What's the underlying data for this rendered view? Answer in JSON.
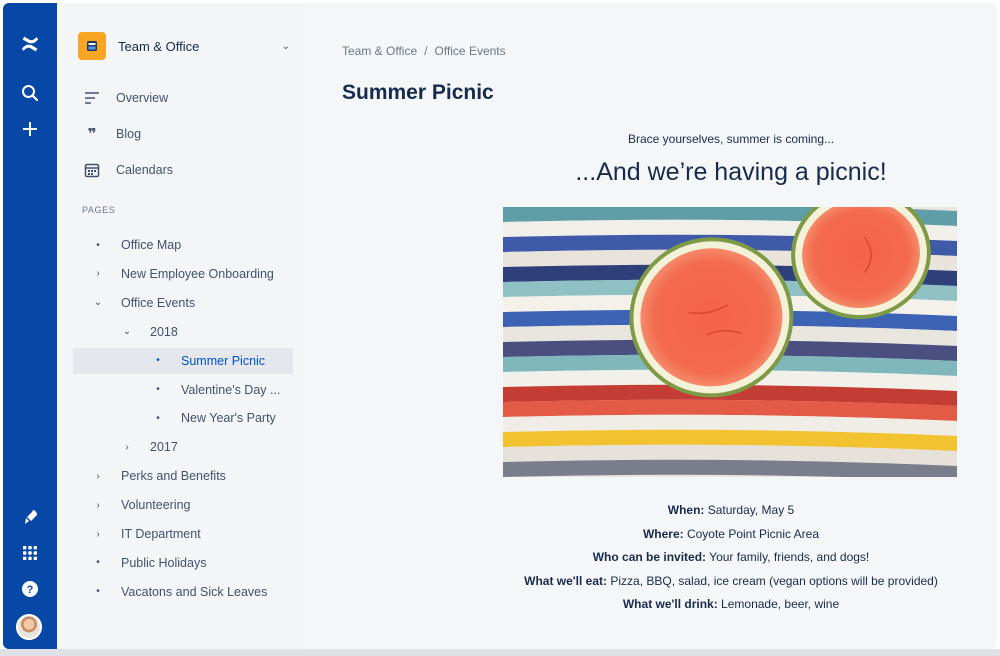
{
  "global_nav": {
    "logo_icon": "confluence-logo-icon",
    "items": [
      "search-icon",
      "create-icon",
      "notifications-rocket-icon",
      "app-switcher-icon",
      "help-icon"
    ]
  },
  "sidebar": {
    "space_name": "Team & Office",
    "links": [
      {
        "label": "Overview",
        "icon": "overview-icon"
      },
      {
        "label": "Blog",
        "icon": "quote-icon"
      },
      {
        "label": "Calendars",
        "icon": "calendar-icon"
      }
    ],
    "pages_heading": "PAGES",
    "tree": [
      {
        "label": "Office Map",
        "marker": "•",
        "level": 0
      },
      {
        "label": "New Employee Onboarding",
        "marker": "›",
        "level": 0
      },
      {
        "label": "Office Events",
        "marker": "⌄",
        "level": 0
      },
      {
        "label": "2018",
        "marker": "⌄",
        "level": 1
      },
      {
        "label": "Summer Picnic",
        "marker": "•",
        "level": 2,
        "selected": true
      },
      {
        "label": "Valentine's Day ...",
        "marker": "•",
        "level": 2
      },
      {
        "label": "New Year's Party",
        "marker": "•",
        "level": 2
      },
      {
        "label": "2017",
        "marker": "›",
        "level": 1
      },
      {
        "label": "Perks and Benefits",
        "marker": "›",
        "level": 0
      },
      {
        "label": "Volunteering",
        "marker": "›",
        "level": 0
      },
      {
        "label": "IT Department",
        "marker": "›",
        "level": 0
      },
      {
        "label": "Public Holidays",
        "marker": "•",
        "level": 0
      },
      {
        "label": "Vacatons and Sick Leaves",
        "marker": "•",
        "level": 0
      }
    ]
  },
  "main": {
    "breadcrumb": [
      "Team & Office",
      "Office Events"
    ],
    "breadcrumb_sep": "/",
    "title": "Summer Picnic",
    "tagline": "Brace yourselves, summer is coming...",
    "headline": "...And we’re having a picnic!",
    "details": [
      {
        "label": "When:",
        "value": " Saturday, May 5"
      },
      {
        "label": "Where:",
        "value": " Coyote Point Picnic Area"
      },
      {
        "label": "Who can be invited:",
        "value": " Your family, friends, and dogs!"
      },
      {
        "label": "What we'll eat:",
        "value": " Pizza, BBQ, salad, ice cream (vegan options will be provided)"
      },
      {
        "label": "What we'll drink:",
        "value": " Lemonade, beer, wine"
      }
    ]
  },
  "colors": {
    "nav_blue": "#0747a6",
    "selected_blue": "#0052cc",
    "space_logo": "#f6a623"
  }
}
